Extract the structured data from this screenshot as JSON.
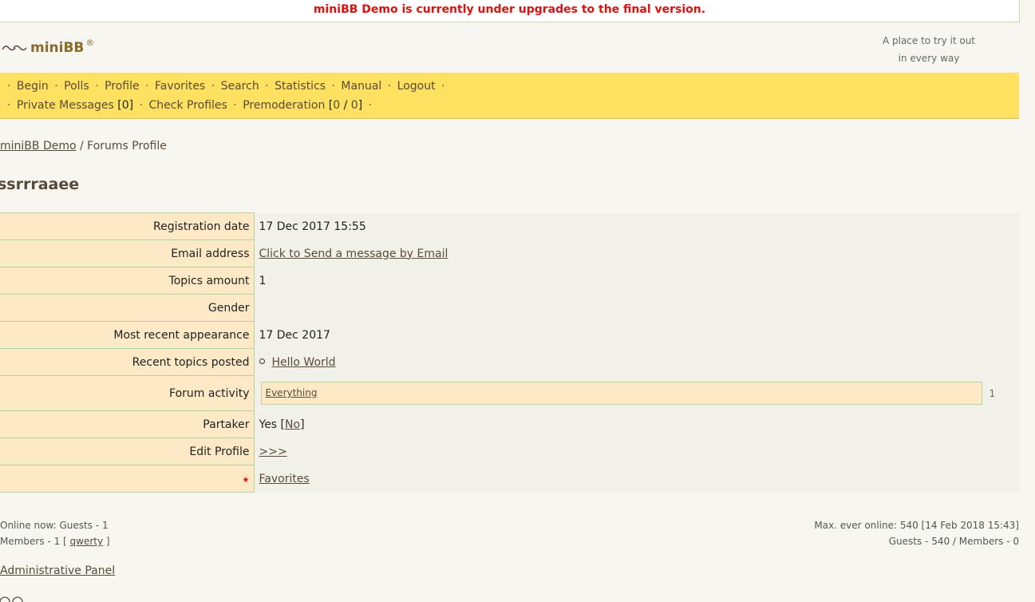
{
  "notice": "miniBB Demo is currently under upgrades to the final version.",
  "logo": {
    "name": "miniBB",
    "reg": "®"
  },
  "tagline": {
    "line1": "A place to try it out",
    "line2": "in every way"
  },
  "nav": {
    "sep": "·",
    "row1": [
      "Begin",
      "Polls",
      "Profile",
      "Favorites",
      "Search",
      "Statistics",
      "Manual",
      "Logout"
    ],
    "private_messages": "Private Messages",
    "pm_count": "0",
    "check_profiles": "Check Profiles",
    "premoderation": "Premoderation",
    "premod_a": "0",
    "premod_b": "0"
  },
  "breadcrumb": {
    "home": "miniBB Demo",
    "sep": "/",
    "current": "Forums Profile"
  },
  "username": "ssrrraaee",
  "profile": {
    "registration_label": "Registration date",
    "registration_value": "17 Dec 2017 15:55",
    "email_label": "Email address",
    "email_link": "Click to Send a message by Email",
    "topics_label": "Topics amount",
    "topics_value": "1",
    "gender_label": "Gender",
    "gender_value": "",
    "appearance_label": "Most recent appearance",
    "appearance_value": "17 Dec 2017",
    "recent_label": "Recent topics posted",
    "recent_topic": "Hello World",
    "activity_label": "Forum activity",
    "activity_link": "Everything",
    "activity_count": "1",
    "activity_fraction": 1.0,
    "partaker_label": "Partaker",
    "partaker_yes": "Yes",
    "partaker_no": "No",
    "edit_label": "Edit Profile",
    "edit_link": ">>>",
    "favorites_link": "Favorites"
  },
  "stats": {
    "online_now": "Online now: Guests - 1",
    "members_prefix": "Members - 1 [",
    "member_name": "qwerty",
    "members_suffix": "]",
    "max_online": "Max. ever online: 540 [14 Feb 2018 15:43]",
    "max_breakdown": "Guests - 540 / Members - 0"
  },
  "admin_panel": "Administrative Panel",
  "colors": {
    "notice_red": "#e01010",
    "nav_yellow": "#fee160",
    "label_bg": "#fde9c6",
    "border_green": "#b9d29a",
    "brand_brown": "#8a6a2a"
  }
}
